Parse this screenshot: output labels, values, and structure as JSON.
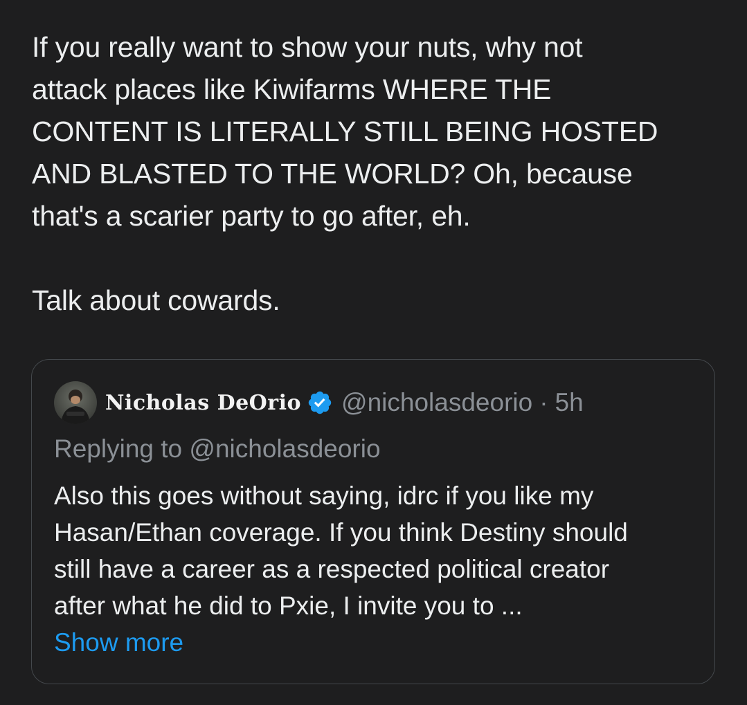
{
  "tweet": {
    "lines": [
      "If you really want to show your nuts, why not",
      "attack places like Kiwifarms WHERE THE",
      "CONTENT IS LITERALLY STILL BEING HOSTED",
      "AND BLASTED TO THE WORLD? Oh, because",
      "that's a scarier party to go after, eh."
    ],
    "closing": "Talk about cowards."
  },
  "quote": {
    "display_name": "Nicholas DeOrio",
    "verified_icon": "verified-badge-icon",
    "handle": "@nicholasdeorio",
    "separator": "·",
    "time": "5h",
    "replying_to": "Replying to @nicholasdeorio",
    "lines": [
      "Also this goes without saying, idrc if you like my",
      "Hasan/Ethan coverage. If you think Destiny should",
      "still have a career as a respected political creator",
      "after what he did to Pxie, I invite you to ..."
    ],
    "show_more": "Show more"
  },
  "colors": {
    "background": "#1e1e1f",
    "text": "#eceeef",
    "muted": "#8b9096",
    "link": "#1d9bf0",
    "verified": "#1d9bf0",
    "border": "#44484c"
  }
}
